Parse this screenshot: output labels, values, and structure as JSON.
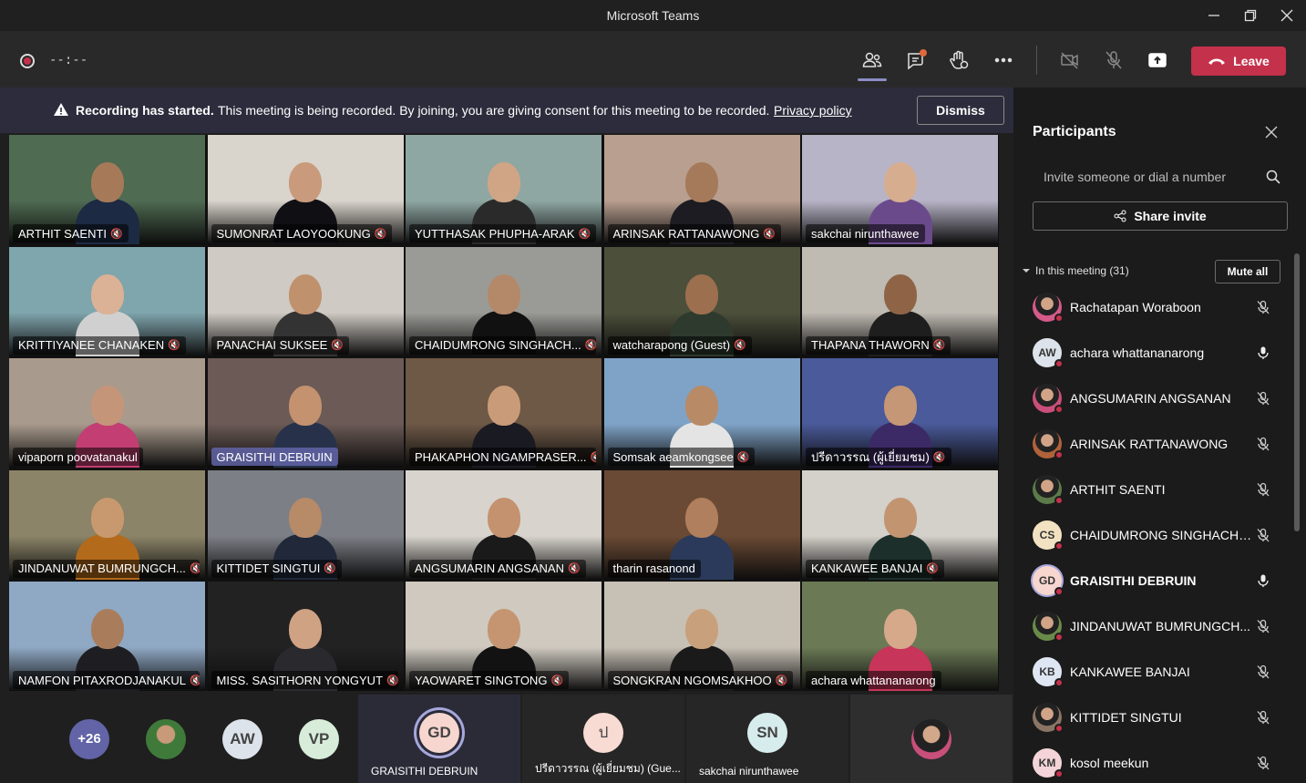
{
  "window": {
    "title": "Microsoft Teams"
  },
  "toolbar": {
    "timer": "--:--",
    "leave_label": "Leave"
  },
  "banner": {
    "title": "Recording has started.",
    "text": "This meeting is being recorded. By joining, you are giving consent for this meeting to be recorded.",
    "link": "Privacy policy",
    "dismiss_label": "Dismiss"
  },
  "grid": [
    {
      "name": "ARTHIT SAENTI",
      "mic": true,
      "bg": "#4f6b52",
      "skin": "#a67a58",
      "shirt": "#1d2a44"
    },
    {
      "name": "SUMONRAT LAOYOOKUNG",
      "mic": true,
      "bg": "#d9d4cc",
      "skin": "#c99a7b",
      "shirt": "#101014"
    },
    {
      "name": "YUTTHASAK PHUPHA-ARAK",
      "mic": true,
      "bg": "#8fa7a2",
      "skin": "#d0a585",
      "shirt": "#2a2a2a"
    },
    {
      "name": "ARINSAK RATTANAWONG",
      "mic": true,
      "bg": "#b99f8f",
      "skin": "#a57a5a",
      "shirt": "#1c1c22"
    },
    {
      "name": "sakchai nirunthawee",
      "mic": false,
      "bg": "#b8b4c7",
      "skin": "#d7ad8f",
      "shirt": "#6b4a8c",
      "hl": true
    },
    {
      "name": "KRITTIYANEE CHANAKEN",
      "mic": true,
      "bg": "#7fa5ad",
      "skin": "#dbb295",
      "shirt": "#d0d0d0"
    },
    {
      "name": "PANACHAI SUKSEE",
      "mic": true,
      "bg": "#cfcac3",
      "skin": "#c0916d",
      "shirt": "#333"
    },
    {
      "name": "CHAIDUMRONG SINGHACH...",
      "mic": true,
      "bg": "#9a9b96",
      "skin": "#b4896a",
      "shirt": "#111"
    },
    {
      "name": "watcharapong (Guest)",
      "mic": true,
      "bg": "#4c4f3a",
      "skin": "#9c6f4f",
      "shirt": "#2e3a2e"
    },
    {
      "name": "THAPANA THAWORN",
      "mic": true,
      "bg": "#bfbab2",
      "skin": "#8f6446",
      "shirt": "#1e1e1e"
    },
    {
      "name": "vipaporn poovatanakul",
      "mic": false,
      "bg": "#a89a8c",
      "skin": "#c5957a",
      "shirt": "#c33e72"
    },
    {
      "name": "GRAISITHI DEBRUIN",
      "mic": false,
      "bg": "#6b5a55",
      "skin": "#c4926f",
      "shirt": "#27324a",
      "hl2": true
    },
    {
      "name": "PHAKAPHON NGAMPRASER...",
      "mic": true,
      "bg": "#6e5846",
      "skin": "#c99b78",
      "shirt": "#1a1a22"
    },
    {
      "name": "Somsak aeamkongsee",
      "mic": true,
      "bg": "#7fa3c7",
      "skin": "#b98a66",
      "shirt": "#e4e4e4"
    },
    {
      "name": "ปรีดาวรรณ (ผู้เยี่ยมชม)",
      "mic": true,
      "bg": "#4a5a9a",
      "skin": "#c59776",
      "shirt": "#3c2a66"
    },
    {
      "name": "JINDANUWAT BUMRUNGCH...",
      "mic": true,
      "bg": "#8c8468",
      "skin": "#c8996f",
      "shirt": "#b36a1a"
    },
    {
      "name": "KITTIDET SINGTUI",
      "mic": true,
      "bg": "#7c7f86",
      "skin": "#b78a68",
      "shirt": "#20283a"
    },
    {
      "name": "ANGSUMARIN ANGSANAN",
      "mic": true,
      "bg": "#d8d4cd",
      "skin": "#c4926f",
      "shirt": "#1a1a1a"
    },
    {
      "name": "tharin rasanond",
      "mic": false,
      "bg": "#6a4a34",
      "skin": "#b07f5d",
      "shirt": "#2b3a5a"
    },
    {
      "name": "KANKAWEE BANJAI",
      "mic": true,
      "bg": "#d4d0ca",
      "skin": "#c29470",
      "shirt": "#1d2f2a"
    },
    {
      "name": "NAMFON PITAXRODJANAKUL",
      "mic": true,
      "bg": "#8fa8c4",
      "skin": "#a97d5b",
      "shirt": "#1e1e22"
    },
    {
      "name": "MISS. SASITHORN YONGYUT",
      "mic": true,
      "bg": "#222",
      "skin": "#d0a284",
      "shirt": "#2a2a2e"
    },
    {
      "name": "YAOWARET SINGTONG",
      "mic": true,
      "bg": "#cfc9c0",
      "skin": "#c49570",
      "shirt": "#121212"
    },
    {
      "name": "SONGKRAN NGOMSAKHOO",
      "mic": true,
      "bg": "#c7c0b5",
      "skin": "#c9a07c",
      "shirt": "#1a1a1a"
    },
    {
      "name": "achara whattananarong",
      "mic": false,
      "bg": "#6b7a55",
      "skin": "#d6a98a",
      "shirt": "#c8355a"
    }
  ],
  "strip": {
    "more_count": "+26",
    "aw": "AW",
    "vp": "VP",
    "gd": "GD",
    "gd_label": "GRAISITHI DEBRUIN",
    "pd": "ป",
    "pd_label": "ปรีดาวรรณ (ผู้เยี่ยมชม) (Gue...",
    "sn": "SN",
    "sn_label": "sakchai nirunthawee"
  },
  "panel": {
    "title": "Participants",
    "invite_placeholder": "Invite someone or dial a number",
    "share_label": "Share invite",
    "in_meeting": "In this meeting (31)",
    "mute_all": "Mute all",
    "participants": [
      {
        "name": "Rachatapan Woraboon",
        "initials": "",
        "photo": true,
        "muted": true,
        "color": "#d45a8a"
      },
      {
        "name": "achara whattananarong",
        "initials": "AW",
        "photo": false,
        "muted": false,
        "color": "#dde3ea"
      },
      {
        "name": "ANGSUMARIN ANGSANAN",
        "initials": "",
        "photo": true,
        "muted": true,
        "color": "#c94f7a"
      },
      {
        "name": "ARINSAK RATTANAWONG",
        "initials": "",
        "photo": true,
        "muted": true,
        "color": "#b0623a"
      },
      {
        "name": "ARTHIT SAENTI",
        "initials": "",
        "photo": true,
        "muted": true,
        "color": "#5c7a4a"
      },
      {
        "name": "CHAIDUMRONG SINGHACHA...",
        "initials": "CS",
        "photo": false,
        "muted": true,
        "color": "#f3e2c2"
      },
      {
        "name": "GRAISITHI DEBRUIN",
        "initials": "GD",
        "photo": false,
        "muted": false,
        "color": "#f6d6cf",
        "bold": true
      },
      {
        "name": "JINDANUWAT BUMRUNGCH...",
        "initials": "",
        "photo": true,
        "muted": true,
        "color": "#6a8a4a"
      },
      {
        "name": "KANKAWEE BANJAI",
        "initials": "KB",
        "photo": false,
        "muted": true,
        "color": "#dfe6f3"
      },
      {
        "name": "KITTIDET SINGTUI",
        "initials": "",
        "photo": true,
        "muted": true,
        "color": "#8a7464"
      },
      {
        "name": "kosol meekun",
        "initials": "KM",
        "photo": false,
        "muted": true,
        "color": "#f4d4d8"
      }
    ]
  },
  "colors": {
    "accent": "#6264a7",
    "leave": "#c4314b",
    "banner": "#2d2c3c"
  }
}
